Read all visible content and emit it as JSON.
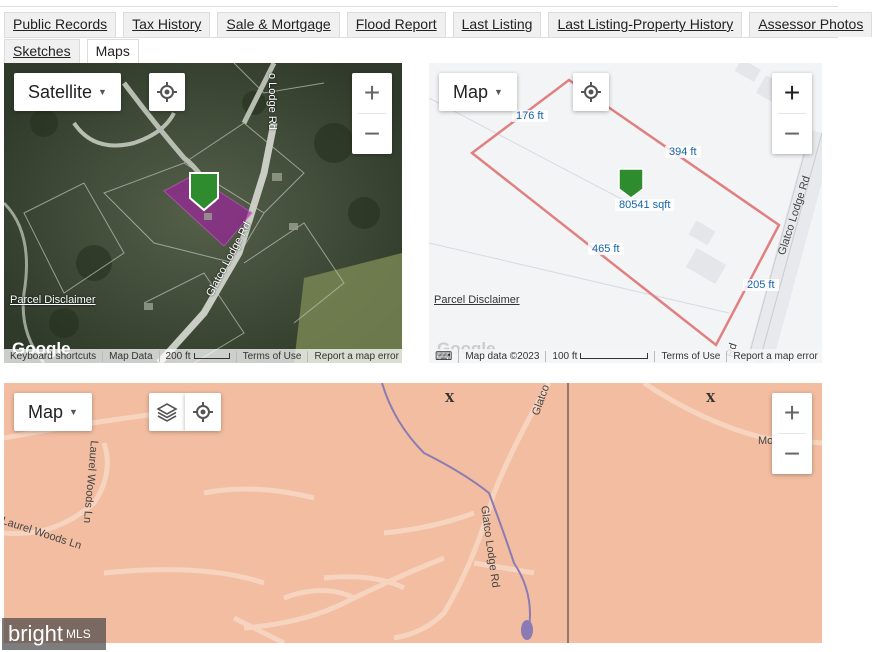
{
  "tabs": {
    "row1": [
      {
        "label": "Public Records"
      },
      {
        "label": "Tax History"
      },
      {
        "label": "Sale & Mortgage"
      },
      {
        "label": "Flood Report"
      },
      {
        "label": "Last Listing"
      },
      {
        "label": "Last Listing-Property History"
      },
      {
        "label": "Assessor Photos"
      }
    ],
    "row2": [
      {
        "label": "Sketches"
      },
      {
        "label": "Maps",
        "active": true
      }
    ]
  },
  "satellite_map": {
    "type_label": "Satellite",
    "zoom_in": "+",
    "zoom_out": "−",
    "road_label_1": "Glatco Lodge Rd",
    "road_label_2": "o Lodge Rd",
    "disclaimer": "Parcel Disclaimer",
    "google": "Google",
    "footer": {
      "shortcuts": "Keyboard shortcuts",
      "map_data": "Map Data",
      "scale": "200 ft",
      "terms": "Terms of Use",
      "report": "Report a map error"
    },
    "colors": {
      "parcel": "#a020a0",
      "pin": "#2e8b2e"
    }
  },
  "parcel_map": {
    "type_label": "Map",
    "zoom_in": "+",
    "zoom_out": "−",
    "dims": {
      "top": "176 ft",
      "right_top": "394 ft",
      "area": "80541 sqft",
      "bottom": "465 ft",
      "right": "205 ft"
    },
    "road_label": "Glatco Lodge Rd",
    "road_label_2": "Rd",
    "disclaimer": "Parcel Disclaimer",
    "google": "Google",
    "footer": {
      "map_data": "Map data ©2023",
      "scale": "100 ft",
      "terms": "Terms of Use",
      "report": "Report a map error"
    },
    "colors": {
      "boundary": "#e08080",
      "pin": "#2e8b2e"
    }
  },
  "flood_map": {
    "type_label": "Map",
    "zoom_in": "+",
    "zoom_out": "−",
    "labels": {
      "laurel_1": "Laurel Woods Ln",
      "laurel_2": "Laurel Woods Ln",
      "glatco_top": "Glatco",
      "glatco": "Glatco Lodge Rd",
      "right_edge": "Mo     n"
    },
    "x_marks": [
      "X",
      "X"
    ],
    "colors": {
      "zone": "#f2bda0",
      "road": "#f7d4bf",
      "stream": "#8b7bb5"
    }
  },
  "watermark": {
    "brand": "bright",
    "suffix": "MLS"
  }
}
